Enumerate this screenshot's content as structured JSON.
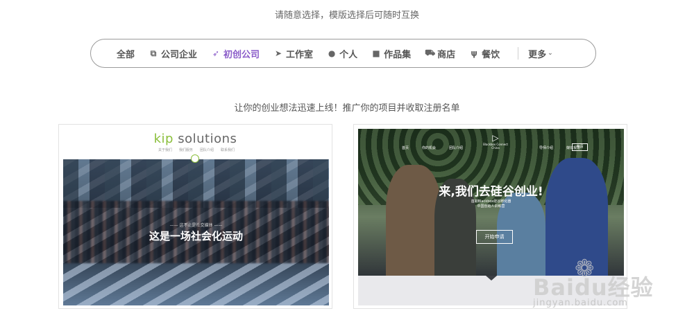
{
  "header": {
    "hint": "请随意选择，模版选择后可随时互换"
  },
  "filters": [
    {
      "label": "全部",
      "icon": ""
    },
    {
      "label": "公司企业",
      "icon": "copy-icon"
    },
    {
      "label": "初创公司",
      "icon": "rocket-icon",
      "active": true
    },
    {
      "label": "工作室",
      "icon": "paper-plane-icon"
    },
    {
      "label": "个人",
      "icon": "user-icon"
    },
    {
      "label": "作品集",
      "icon": "briefcase-icon"
    },
    {
      "label": "商店",
      "icon": "cart-icon"
    },
    {
      "label": "餐饮",
      "icon": "cutlery-icon"
    }
  ],
  "more_label": "更多",
  "section_subtitle": "让你的创业想法迅速上线！推广你的项目并收取注册名单",
  "colors": {
    "accent": "#8a5cc9",
    "kip_green": "#8bbf3c"
  },
  "card1": {
    "logo_k": "kip",
    "logo_rest": " solutions",
    "nav": [
      "关于我们",
      "我们服务",
      "团队介绍",
      "联系我们"
    ],
    "tagline_small": "—— 这不止是社交媒体 ——",
    "headline": "这是一场社会化运动"
  },
  "card2": {
    "nav": [
      "首页",
      "你的机会",
      "团队介绍",
      "导师介绍",
      "媒体报道"
    ],
    "logo_line1": "Blackbox Connect",
    "logo_line2": "China",
    "apply_top": "申请",
    "headline": "来,我们去硅谷创业!",
    "sub1": "首期Blackbox硅谷孵化器",
    "sub2": "中国创始人训练营",
    "cta": "开始申请"
  },
  "watermark": {
    "brand": "Baidu经验",
    "url": "jingyan.baidu.com"
  }
}
